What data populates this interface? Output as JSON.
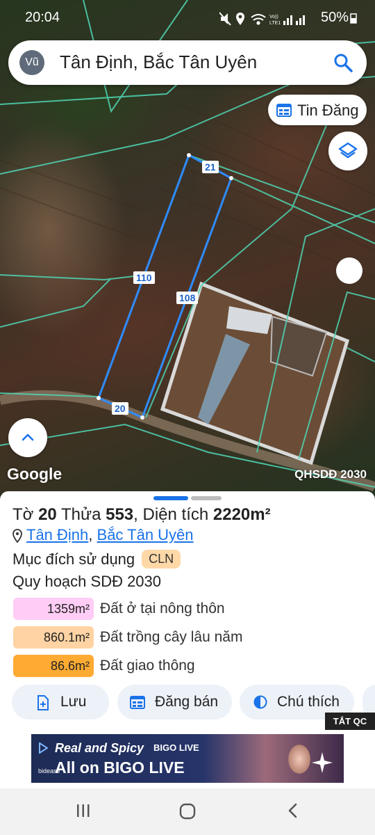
{
  "status_bar": {
    "time": "20:04",
    "battery": "50%"
  },
  "search": {
    "avatar_initials": "Vũ",
    "query": "Tân Định, Bắc Tân Uyên"
  },
  "map": {
    "tin_dang_label": "Tin Đăng",
    "google_label": "Google",
    "plan_label": "QHSDĐ 2030",
    "edge_labels": {
      "top": "21",
      "left": "110",
      "right": "108",
      "bottom": "20"
    }
  },
  "parcel": {
    "to_label": "Tờ",
    "to_number": "20",
    "thua_label": "Thửa",
    "thua_number": "553",
    "area_label": "Diện tích",
    "area_value": "2220m²",
    "commune": "Tân Định",
    "district": "Bắc Tân Uyên",
    "purpose_label": "Mục đích sử dụng",
    "purpose_code": "CLN",
    "plan_title": "Quy hoạch SDĐ 2030",
    "land_uses": [
      {
        "area": "1359m²",
        "name": "Đất ở tại nông thôn",
        "color": "#ffcdf5"
      },
      {
        "area": "860.1m²",
        "name": "Đất trồng cây lâu năm",
        "color": "#ffd3a3"
      },
      {
        "area": "86.6m²",
        "name": "Đất giao thông",
        "color": "#ffaa33"
      }
    ]
  },
  "actions": {
    "save": "Lưu",
    "post_sale": "Đăng bán",
    "legend": "Chú thích"
  },
  "ad": {
    "close_label": "TẮT QC",
    "line1": "Real and Spicy",
    "brand": "BIGO LIVE",
    "line2": "All on BIGO LIVE",
    "sponsor": "bidease"
  },
  "colors": {
    "accent": "#1a73e8",
    "parcel_line": "#2f8cff",
    "cadastral_line": "#4fd6b4"
  }
}
